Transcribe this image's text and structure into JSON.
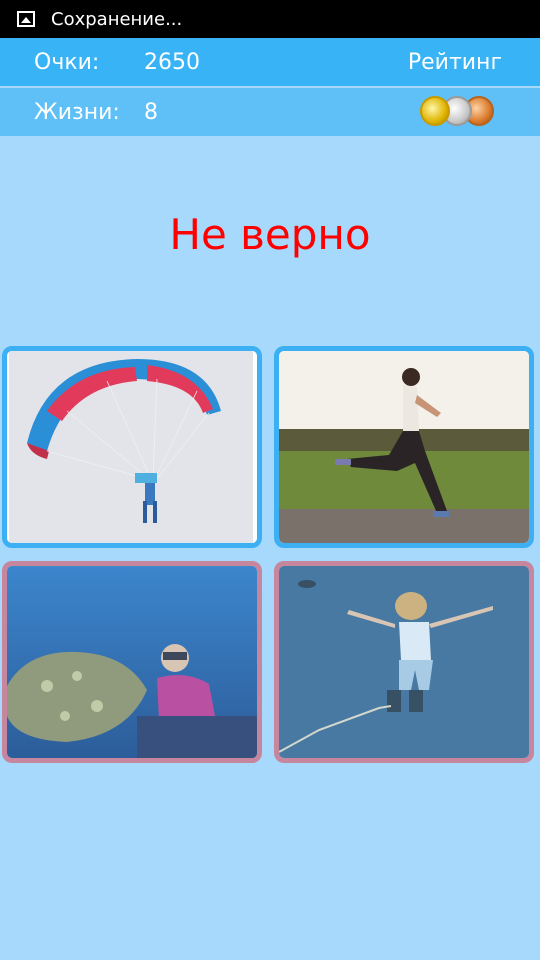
{
  "status_bar": {
    "text": "Сохранение...",
    "icon": "image-icon"
  },
  "score": {
    "label": "Очки:",
    "value": "2650",
    "rating_label": "Рейтинг"
  },
  "lives": {
    "label": "Жизни:",
    "value": "8",
    "medals_icon": "medals-icon"
  },
  "message": {
    "text": "Не верно",
    "color": "#ff0000"
  },
  "colors": {
    "top_bar": "#38b3f6",
    "second_bar": "#5ec0f7",
    "background": "#a6d9fb",
    "correct_border": "#3db0f3",
    "wrong_border": "#cf6f85"
  },
  "tiles": [
    {
      "image": "paraglider-photo",
      "state": "normal"
    },
    {
      "image": "runner-photo",
      "state": "normal"
    },
    {
      "image": "scuba-diver-photo",
      "state": "wrong"
    },
    {
      "image": "bungee-jumper-photo",
      "state": "wrong"
    }
  ]
}
